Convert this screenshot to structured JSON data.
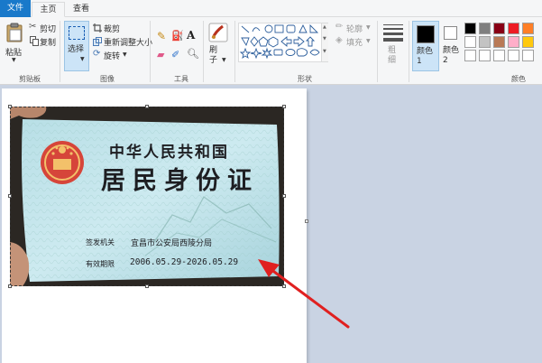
{
  "tabs": [
    {
      "label": "文件"
    },
    {
      "label": "主页"
    },
    {
      "label": "查看"
    }
  ],
  "clipboard": {
    "paste_label": "粘贴",
    "cut_label": "剪切",
    "copy_label": "复制",
    "group_label": "剪贴板"
  },
  "image": {
    "select_label": "选择",
    "crop_label": "裁剪",
    "resize_label": "重新调整大小",
    "rotate_label": "旋转",
    "group_label": "图像"
  },
  "tools": {
    "group_label": "工具",
    "text_icon_glyph": "A"
  },
  "brushes": {
    "label": "刷子"
  },
  "shapes": {
    "outline_label": "轮廓",
    "fill_label": "填充",
    "group_label": "形状"
  },
  "size": {
    "label": "粗细"
  },
  "colors": {
    "color1_label": "颜色 1",
    "color2_label": "颜色 2",
    "group_label": "颜色",
    "color1": "#000000",
    "color2": "#ffffff",
    "palette": [
      "#000000",
      "#7f7f7f",
      "#880015",
      "#ed1c24",
      "#ff7f27",
      "#ffffff",
      "#c3c3c3",
      "#b97a57",
      "#ffaec9",
      "#ffc90e",
      "#ffffff",
      "#ffffff",
      "#ffffff",
      "#ffffff",
      "#ffffff"
    ]
  },
  "id_card": {
    "country": "中华人民共和国",
    "title": "居民身份证",
    "issuer_label": "签发机关",
    "issuer_value": "宜昌市公安局西陵分局",
    "validity_label": "有效期限",
    "validity_value": "2006.05.29-2026.05.29"
  },
  "annotation": {
    "arrow_color": "#e02020"
  }
}
